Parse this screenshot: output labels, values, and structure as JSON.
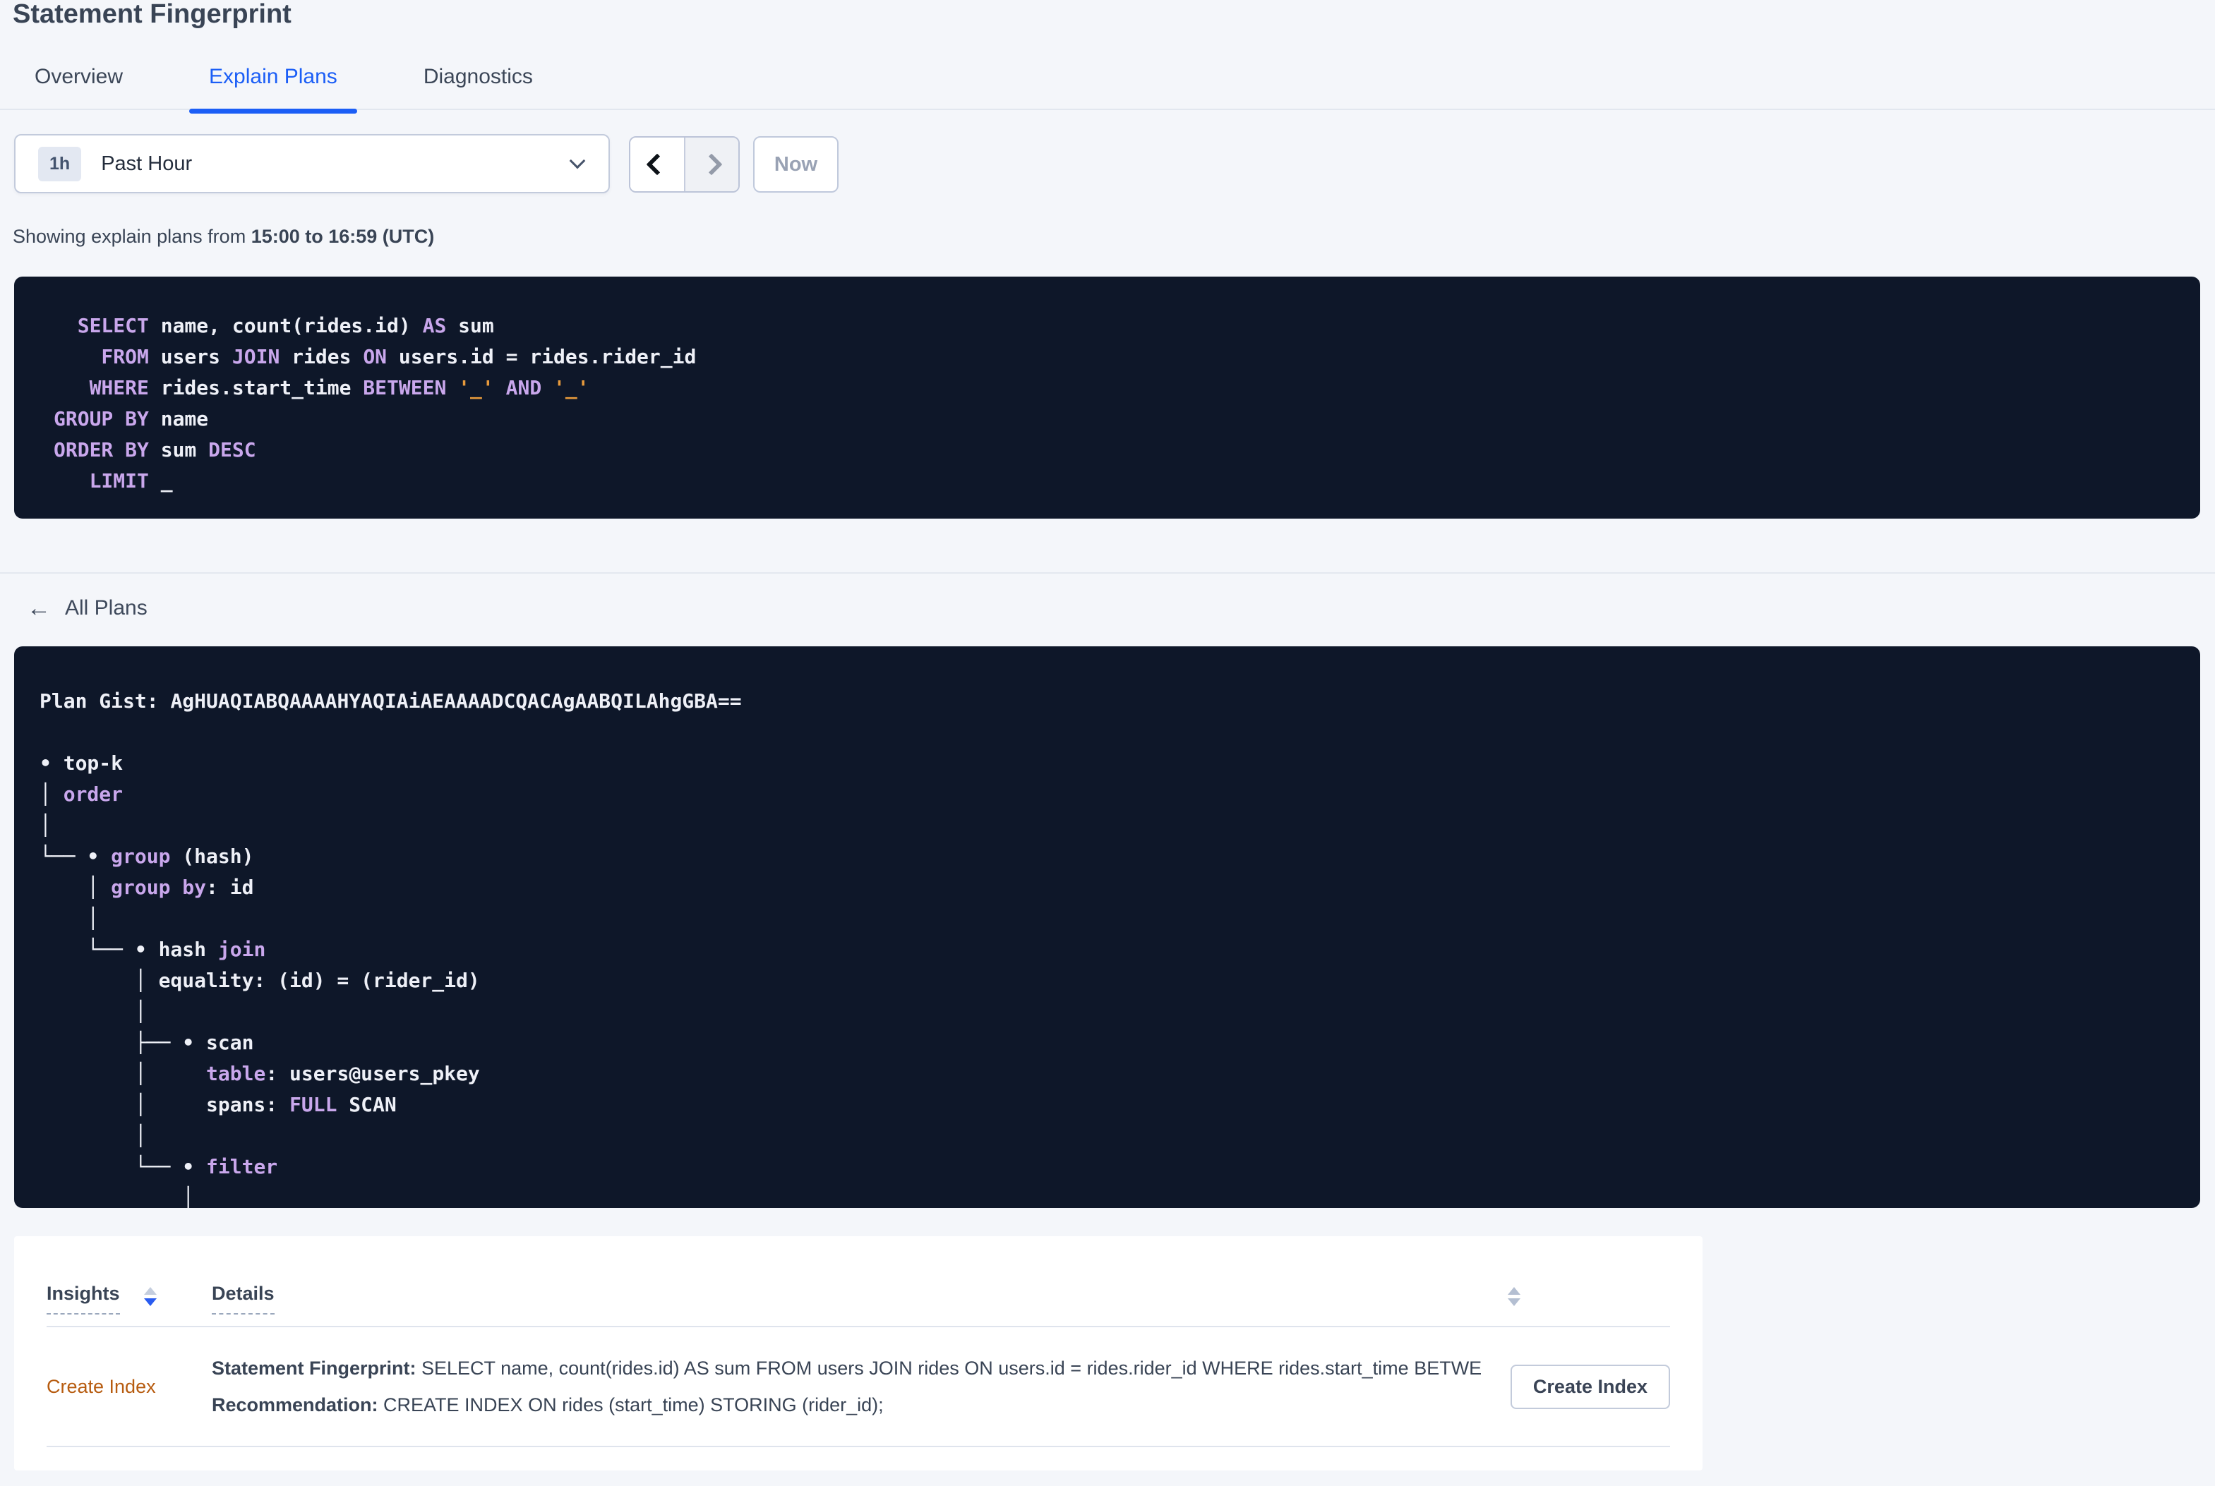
{
  "header": {
    "title": "Statement Fingerprint"
  },
  "tabs": [
    {
      "label": "Overview"
    },
    {
      "label": "Explain Plans"
    },
    {
      "label": "Diagnostics"
    }
  ],
  "toolbar": {
    "range_badge": "1h",
    "range_label": "Past Hour",
    "now_label": "Now"
  },
  "subtitle": {
    "prefix": "Showing explain plans from ",
    "range_bold": "15:00 to 16:59 (UTC)"
  },
  "sql": {
    "lines": [
      [
        {
          "t": "  SELECT",
          "c": "kw"
        },
        {
          "t": " name, count(rides.id) ",
          "c": "id"
        },
        {
          "t": "AS",
          "c": "kw"
        },
        {
          "t": " sum",
          "c": "id"
        }
      ],
      [
        {
          "t": "    FROM",
          "c": "kw"
        },
        {
          "t": " users ",
          "c": "id"
        },
        {
          "t": "JOIN",
          "c": "kw"
        },
        {
          "t": " rides ",
          "c": "id"
        },
        {
          "t": "ON",
          "c": "kw"
        },
        {
          "t": " users.id = rides.rider_id",
          "c": "id"
        }
      ],
      [
        {
          "t": "   WHERE",
          "c": "kw"
        },
        {
          "t": " rides.start_time ",
          "c": "id"
        },
        {
          "t": "BETWEEN",
          "c": "kw"
        },
        {
          "t": " ",
          "c": "id"
        },
        {
          "t": "'_'",
          "c": "lit"
        },
        {
          "t": " ",
          "c": "id"
        },
        {
          "t": "AND",
          "c": "kw"
        },
        {
          "t": " ",
          "c": "id"
        },
        {
          "t": "'_'",
          "c": "lit"
        }
      ],
      [
        {
          "t": "GROUP BY",
          "c": "kw"
        },
        {
          "t": " name",
          "c": "id"
        }
      ],
      [
        {
          "t": "ORDER BY",
          "c": "kw"
        },
        {
          "t": " sum ",
          "c": "id"
        },
        {
          "t": "DESC",
          "c": "kw"
        }
      ],
      [
        {
          "t": "   LIMIT",
          "c": "kw"
        },
        {
          "t": " _",
          "c": "id"
        }
      ]
    ]
  },
  "nav": {
    "back_label": "All Plans",
    "back_arrow": "←"
  },
  "plan": {
    "gist_label": "Plan Gist: ",
    "gist": "AgHUAQIABQAAAAHYAQIAiAEAAAADCQACAgAABQILAhgGBA==",
    "tree": [
      [
        {
          "t": "• top-k",
          "c": "plain"
        }
      ],
      [
        {
          "t": "│ ",
          "c": "plain"
        },
        {
          "t": "order",
          "c": "kw"
        }
      ],
      [
        {
          "t": "│",
          "c": "plain"
        }
      ],
      [
        {
          "t": "└── • ",
          "c": "plain"
        },
        {
          "t": "group",
          "c": "kw"
        },
        {
          "t": " (hash)",
          "c": "plain"
        }
      ],
      [
        {
          "t": "    │ ",
          "c": "plain"
        },
        {
          "t": "group by",
          "c": "kw"
        },
        {
          "t": ": id",
          "c": "plain"
        }
      ],
      [
        {
          "t": "    │",
          "c": "plain"
        }
      ],
      [
        {
          "t": "    └── • hash ",
          "c": "plain"
        },
        {
          "t": "join",
          "c": "kw"
        }
      ],
      [
        {
          "t": "        │ equality: (id) = (rider_id)",
          "c": "plain"
        }
      ],
      [
        {
          "t": "        │",
          "c": "plain"
        }
      ],
      [
        {
          "t": "        ├── • scan",
          "c": "plain"
        }
      ],
      [
        {
          "t": "        │     ",
          "c": "plain"
        },
        {
          "t": "table",
          "c": "kw"
        },
        {
          "t": ": users@users_pkey",
          "c": "plain"
        }
      ],
      [
        {
          "t": "        │     spans: ",
          "c": "plain"
        },
        {
          "t": "FULL",
          "c": "kw"
        },
        {
          "t": " SCAN",
          "c": "plain"
        }
      ],
      [
        {
          "t": "        │",
          "c": "plain"
        }
      ],
      [
        {
          "t": "        └── • ",
          "c": "plain"
        },
        {
          "t": "filter",
          "c": "kw"
        }
      ],
      [
        {
          "t": "            │",
          "c": "plain"
        }
      ],
      [
        {
          "t": "            │",
          "c": "plain"
        }
      ]
    ]
  },
  "table": {
    "col_insights": "Insights",
    "col_details": "Details",
    "rows": [
      {
        "insight": "Create Index",
        "fingerprint_label": "Statement Fingerprint:",
        "fingerprint": " SELECT name, count(rides.id) AS sum FROM users JOIN rides ON users.id = rides.rider_id WHERE rides.start_time BETWEEN '_...",
        "recommendation_label": "Recommendation:",
        "recommendation": " CREATE INDEX ON rides (start_time) STORING (rider_id);",
        "action": "Create Index"
      }
    ]
  },
  "colors": {
    "accent_blue": "#1b5ef6",
    "link_orange": "#b75c10",
    "keyword_purple": "#c9a7ec",
    "literal_orange": "#e79a3c",
    "code_white": "#eef0f7",
    "dark_card_bg": "#0e1729",
    "page_bg": "#f4f6fa",
    "text_dark": "#394455",
    "sort_active_blue": "#2a5cf0"
  }
}
